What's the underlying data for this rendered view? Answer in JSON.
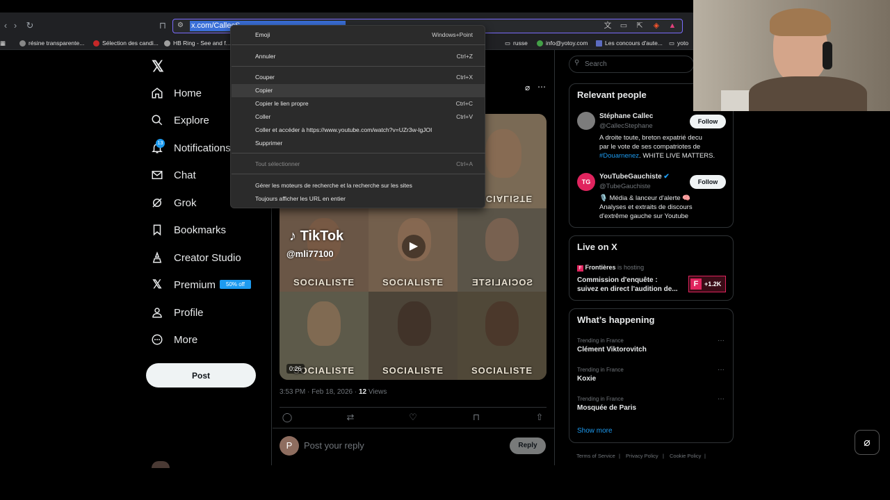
{
  "browser": {
    "url": "x.com/CallecS",
    "bookmarks": [
      "résine transparente...",
      "Sélection des candi...",
      "HB Ring - See and f...",
      "russe",
      "info@yotoy.com",
      "Les concours d'aute...",
      "yoto"
    ]
  },
  "nav": {
    "items": [
      {
        "label": "Home",
        "icon": "home-icon"
      },
      {
        "label": "Explore",
        "icon": "search-icon"
      },
      {
        "label": "Notifications",
        "icon": "bell-icon"
      },
      {
        "label": "Chat",
        "icon": "mail-icon"
      },
      {
        "label": "Grok",
        "icon": "grok-icon"
      },
      {
        "label": "Bookmarks",
        "icon": "bookmark-icon"
      },
      {
        "label": "Creator Studio",
        "icon": "creator-icon"
      },
      {
        "label": "Premium",
        "icon": "x-icon"
      },
      {
        "label": "Profile",
        "icon": "person-icon"
      },
      {
        "label": "More",
        "icon": "more-icon"
      }
    ],
    "notification_count": "13",
    "premium_tag": "50% off",
    "post_label": "Post"
  },
  "tweet": {
    "video": {
      "tiktok_label": "TikTok",
      "tiktok_handle": "@mli77100",
      "duration": "0:26",
      "captions": [
        "SOCIALISTE",
        "SOCIALISTE",
        "SOCIALISTE",
        "SOCIALISTE",
        "SOCIALISTE",
        "SOCIALISTE",
        "SOCIALISTE"
      ]
    },
    "time": "3:53 PM · Feb 18, 2026 · ",
    "views_count": "12",
    "views_label": " Views",
    "reply_placeholder": "Post your reply",
    "reply_button": "Reply",
    "avatar_letter": "P"
  },
  "right": {
    "search_placeholder": "Search",
    "relevant_title": "Relevant people",
    "people": [
      {
        "name": "Stéphane Callec",
        "handle": "@CallecStephane",
        "bio_line1": "A droite toute, breton expatrié decu",
        "bio_line2": "par le vote de ses compatriotes de",
        "bio_hashtag": "#Douarnenez",
        "bio_line3": ". WHITE LIVE MATTERS.",
        "follow": "Follow"
      },
      {
        "name": "YouTubeGauchiste",
        "handle": "@TubeGauchiste",
        "avatar": "TG",
        "bio_line1": "🎙️ Média & lanceur d'alerte 🧠",
        "bio_line2": "Analyses et extraits de discours",
        "bio_line3": "d'extrême gauche sur Youtube",
        "follow": "Follow"
      }
    ],
    "live_title": "Live on X",
    "live_host": "Frontières",
    "live_hosting": "is hosting",
    "live_line1": "Commission d'enquête :",
    "live_line2": "suivez en direct l'audition de...",
    "live_count": "+1.2K",
    "happening_title": "What’s happening",
    "trends": [
      {
        "context": "Trending in France",
        "name": "Clément Viktorovitch"
      },
      {
        "context": "Trending in France",
        "name": "Koxie"
      },
      {
        "context": "Trending in France",
        "name": "Mosquée de Paris"
      }
    ],
    "show_more": "Show more",
    "footer": [
      "Terms of Service",
      "|",
      "Privacy Policy",
      "|",
      "Cookie Policy",
      "|"
    ]
  },
  "context_menu": {
    "items": [
      {
        "label": "Emoji",
        "shortcut": "Windows+Point"
      },
      {
        "label": "Annuler",
        "shortcut": "Ctrl+Z"
      },
      {
        "label": "Couper",
        "shortcut": "Ctrl+X"
      },
      {
        "label": "Copier",
        "shortcut": ""
      },
      {
        "label": "Copier le lien propre",
        "shortcut": "Ctrl+C"
      },
      {
        "label": "Coller",
        "shortcut": "Ctrl+V"
      },
      {
        "label": "Coller et accéder à https://www.youtube.com/watch?v=UZr3w-lgJOI",
        "shortcut": ""
      },
      {
        "label": "Supprimer",
        "shortcut": ""
      },
      {
        "label": "Tout sélectionner",
        "shortcut": "Ctrl+A"
      },
      {
        "label": "Gérer les moteurs de recherche et la recherche sur les sites",
        "shortcut": ""
      },
      {
        "label": "Toujours afficher les URL en entier",
        "shortcut": ""
      }
    ]
  },
  "colors": {
    "accent": "#1d9bf0",
    "background": "#000000",
    "border": "#2f3336",
    "muted": "#71767b"
  }
}
